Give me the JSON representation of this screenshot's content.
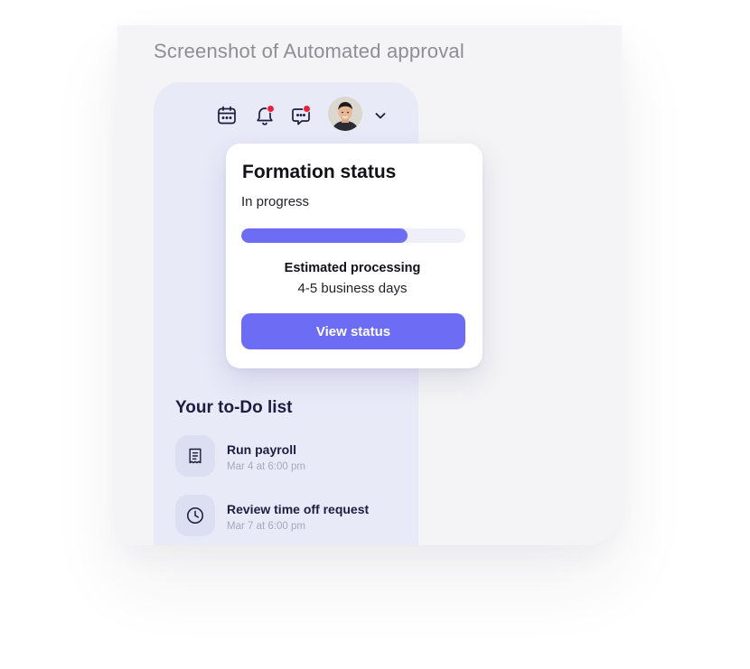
{
  "caption": "Screenshot of Automated approval",
  "topbar": {
    "icons": [
      "calendar-icon",
      "bell-icon",
      "chat-icon",
      "avatar",
      "chevron-down-icon"
    ],
    "notification_color": "#e8223a"
  },
  "status_card": {
    "title": "Formation status",
    "status": "In progress",
    "progress": 0.74,
    "estimate_label": "Estimated processing",
    "estimate_value": "4-5 business days",
    "button_label": "View status",
    "accent": "#6c6cf4"
  },
  "todo": {
    "title": "Your to-Do list",
    "items": [
      {
        "label": "Run payroll",
        "date": "Mar 4 at 6:00 pm",
        "icon": "receipt-icon"
      },
      {
        "label": "Review time off request",
        "date": "Mar 7 at 6:00 pm",
        "icon": "clock-icon"
      }
    ]
  }
}
